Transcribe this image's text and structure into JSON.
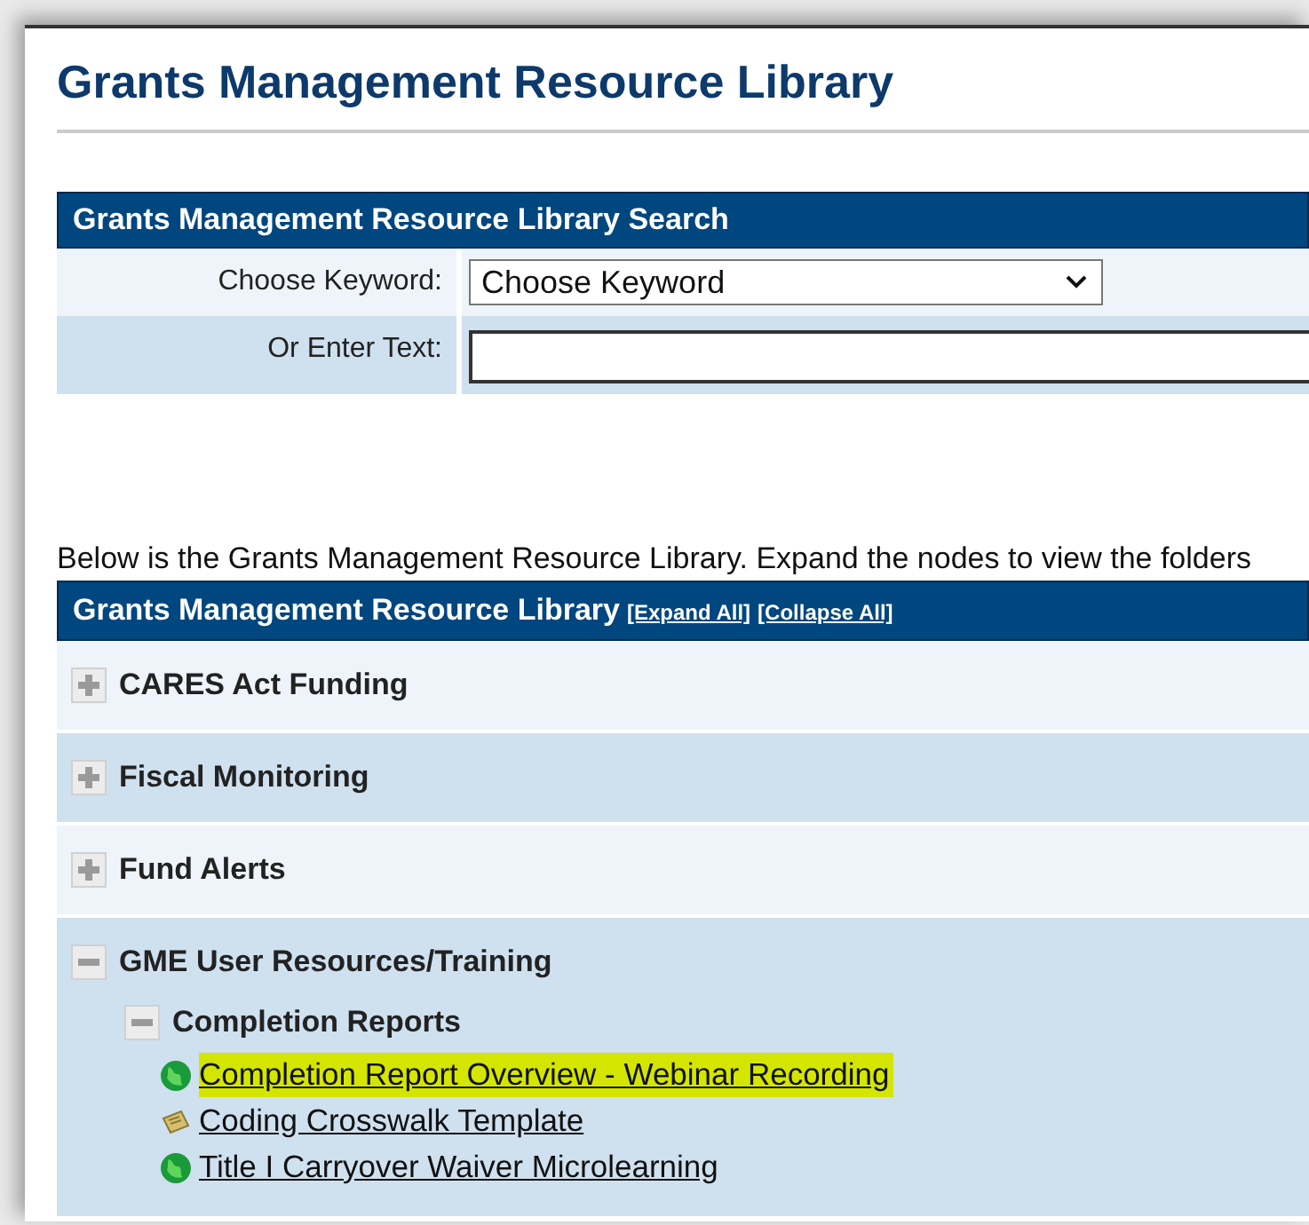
{
  "page_title": "Grants Management Resource Library",
  "search": {
    "title": "Grants Management Resource Library Search",
    "fields": [
      {
        "kind": "select",
        "label": "Choose Keyword:",
        "value": "Choose Keyword"
      },
      {
        "kind": "text",
        "label": "Or Enter Text:"
      }
    ]
  },
  "intro": "Below is the Grants Management Resource Library. Expand the nodes to view the folders",
  "tree": {
    "title": "Grants Management Resource Library",
    "links": [
      "[Expand All]",
      "[Collapse All]"
    ],
    "items": [
      {
        "kind": "folder",
        "label": "CARES Act Funding",
        "expanded": false
      },
      {
        "kind": "folder",
        "label": "Fiscal Monitoring",
        "expanded": false
      },
      {
        "kind": "folder",
        "label": "Fund Alerts",
        "expanded": false
      },
      {
        "kind": "folder",
        "label": "GME User Resources/Training",
        "expanded": true,
        "children": [
          {
            "kind": "folder",
            "label": "Completion Reports",
            "expanded": true,
            "children": [
              {
                "kind": "weblink",
                "label": "Completion Report Overview - Webinar Recording",
                "highlighted": true
              },
              {
                "kind": "filelink",
                "label": "Coding Crosswalk Template",
                "highlighted": false
              },
              {
                "kind": "weblink",
                "label": "Title I Carryover Waiver Microlearning",
                "highlighted": false
              }
            ]
          }
        ]
      }
    ]
  }
}
